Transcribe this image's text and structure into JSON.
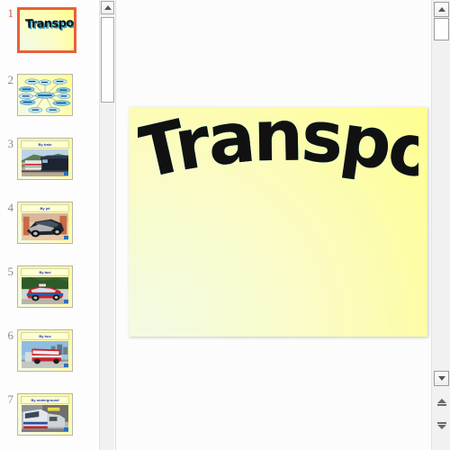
{
  "app": {
    "title": "Transport",
    "view": "Normal",
    "current_slide": 1,
    "colors": {
      "selection": "#e8603c",
      "slide_bg_light": "#f2fbe2",
      "slide_bg_yellow": "#ffff88",
      "wordart_face": "#141414",
      "wordart_extrude": "#1f93c4",
      "thumb_border": "#b4b4b4",
      "pane_bg": "#fdfdfd",
      "scrollbar_bg": "#f1f1f1",
      "title_text": "#2030c0"
    }
  },
  "slide_pane": {
    "name": "Slides",
    "slides": [
      {
        "number": "1",
        "kind": "title",
        "title": "Transport",
        "selected": true,
        "has_badge": false
      },
      {
        "number": "2",
        "kind": "mindmap",
        "title": "Transport",
        "selected": false,
        "has_badge": false,
        "mindmap": {
          "center": "Transport",
          "nodes": [
            "Train",
            "Bus",
            "Car",
            "Plane",
            "Bicycle",
            "Ship",
            "Taxi",
            "Tram",
            "Underground",
            "Lorry",
            "Van"
          ]
        }
      },
      {
        "number": "3",
        "kind": "photo",
        "title": "By train",
        "selected": false,
        "has_badge": true,
        "photo": "train-on-track"
      },
      {
        "number": "4",
        "kind": "photo",
        "title": "By jet",
        "selected": false,
        "has_badge": true,
        "photo": "dark-sports-car"
      },
      {
        "number": "5",
        "kind": "photo",
        "title": "By taxi",
        "selected": false,
        "has_badge": true,
        "photo": "red-taxi-car"
      },
      {
        "number": "6",
        "kind": "photo",
        "title": "By bus",
        "selected": false,
        "has_badge": true,
        "photo": "red-double-decker-bus"
      },
      {
        "number": "7",
        "kind": "photo",
        "title": "By underground",
        "selected": false,
        "has_badge": true,
        "photo": "underground-tube-train"
      }
    ]
  },
  "slide_view": {
    "wordart_text": "Transport",
    "wordart_style": "3d-extruded-arch"
  },
  "scrollbars": {
    "thumb_pane": {
      "up_icon": "triangle-up-icon",
      "thumb_label": "thumb-pane-scroll-thumb"
    },
    "main": {
      "up_icon": "triangle-up-icon",
      "down_icon": "triangle-down-icon",
      "prev_slide_icon": "double-triangle-up-icon",
      "next_slide_icon": "double-triangle-down-icon"
    }
  }
}
